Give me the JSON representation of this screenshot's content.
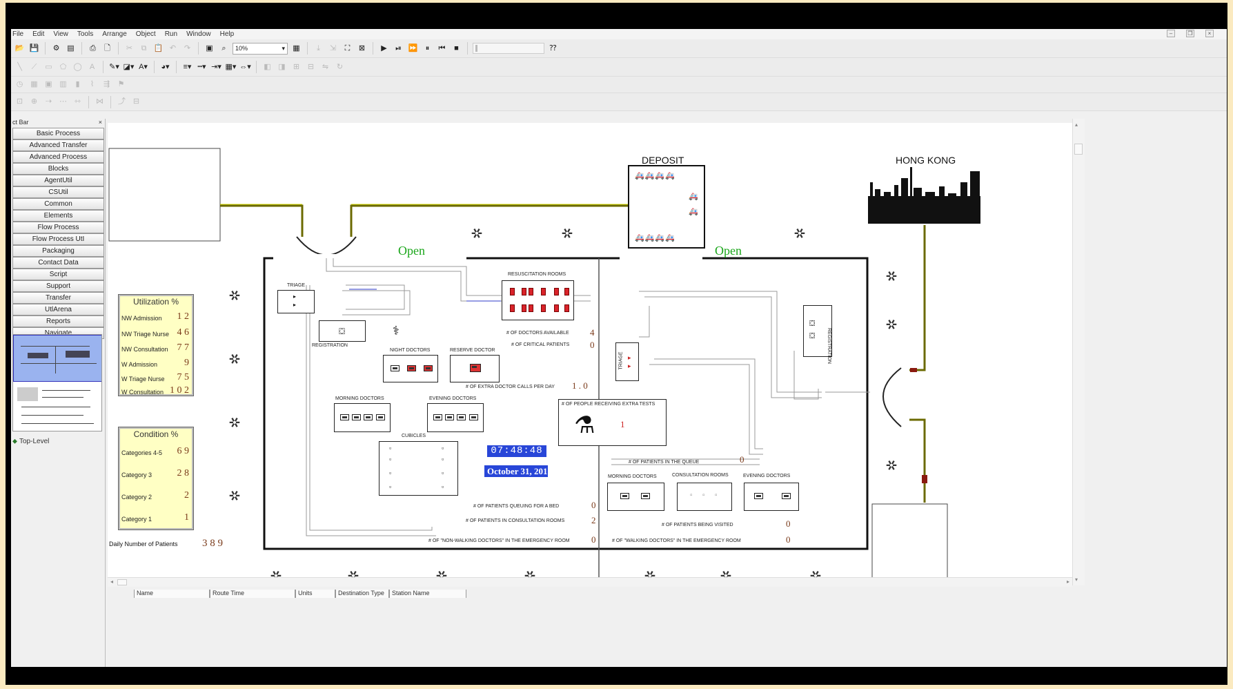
{
  "menu": [
    "File",
    "Edit",
    "View",
    "Tools",
    "Arrange",
    "Object",
    "Run",
    "Window",
    "Help"
  ],
  "toolbar": {
    "zoom": "10%"
  },
  "sidebar": {
    "header": "ct Bar",
    "panels": [
      "Basic Process",
      "Advanced Transfer",
      "Advanced Process",
      "Blocks",
      "AgentUtil",
      "CSUtil",
      "Common",
      "Elements",
      "Flow Process",
      "Flow Process UtI",
      "Packaging",
      "Contact Data",
      "Script",
      "Support",
      "Transfer",
      "UtlArena",
      "Reports",
      "Navigate"
    ],
    "tree_item": "Top-Level"
  },
  "model": {
    "deposit_title": "DEPOSIT",
    "hongkong_title": "HONG KONG",
    "open_label": "Open",
    "clock": "07:48:48",
    "date": "October 31, 201",
    "utilization": {
      "title": "Utilization  %",
      "rows": [
        {
          "label": "NW Admission",
          "value": "1 2"
        },
        {
          "label": "NW Triage Nurse",
          "value": "4 6"
        },
        {
          "label": "NW Consultation",
          "value": "7 7"
        },
        {
          "label": "W Admission",
          "value": "9"
        },
        {
          "label": "W Triage Nurse",
          "value": "7 5"
        },
        {
          "label": "W Consultation",
          "value": "1 0 2"
        }
      ]
    },
    "condition": {
      "title": "Condition  %",
      "rows": [
        {
          "label": "Categories 4-5",
          "value": "6 9"
        },
        {
          "label": "Category 3",
          "value": "2 8"
        },
        {
          "label": "Category 2",
          "value": "2"
        },
        {
          "label": "Category 1",
          "value": "1"
        }
      ]
    },
    "daily_patients": {
      "label": "Daily Number of Patients",
      "value": "3 8 9"
    },
    "rooms": {
      "triage_left": "TRIAGE",
      "registration": "REGISTRATION",
      "resuscitation": "RESUSCITATION ROOMS",
      "night_doctors": "NIGHT DOCTORS",
      "reserve_doctor": "RESERVE DOCTOR",
      "morning_doctors": "MORNING DOCTORS",
      "evening_doctors": "EVENING DOCTORS",
      "cubicles": "CUBICLES",
      "triage_right": "TRIAGE",
      "registration_right": "REGISTRATION",
      "morning_doctors_r": "MORNING DOCTORS",
      "consultation_rooms": "CONSULTATION ROOMS",
      "evening_doctors_r": "EVENING DOCTORS"
    },
    "counters": [
      {
        "label": "# OF DOCTORS AVAILABLE",
        "value": "4"
      },
      {
        "label": "# OF CRITICAL PATIENTS",
        "value": "0"
      },
      {
        "label": "# OF EXTRA DOCTOR CALLS PER DAY",
        "value": "1 . 0"
      },
      {
        "label": "# OF PEOPLE RECEIVING EXTRA TESTS",
        "value": "1"
      },
      {
        "label": "# OF PATIENTS IN THE QUEUE",
        "value": "0"
      },
      {
        "label": "# OF PATIENTS QUEUING FOR A BED",
        "value": "0"
      },
      {
        "label": "# OF PATIENTS IN CONSULTATION ROOMS",
        "value": "2"
      },
      {
        "label": "# OF \"NON-WALKING DOCTORS\" IN THE EMERGENCY ROOM",
        "value": "0"
      },
      {
        "label": "# OF PATIENTS BEING VISITED",
        "value": "0"
      },
      {
        "label": "# OF \"WALKING DOCTORS\" IN THE EMERGENCY ROOM",
        "value": "0"
      }
    ]
  },
  "bottom_table": {
    "columns": [
      "Name",
      "Route Time",
      "Units",
      "Destination Type",
      "Station Name"
    ]
  }
}
